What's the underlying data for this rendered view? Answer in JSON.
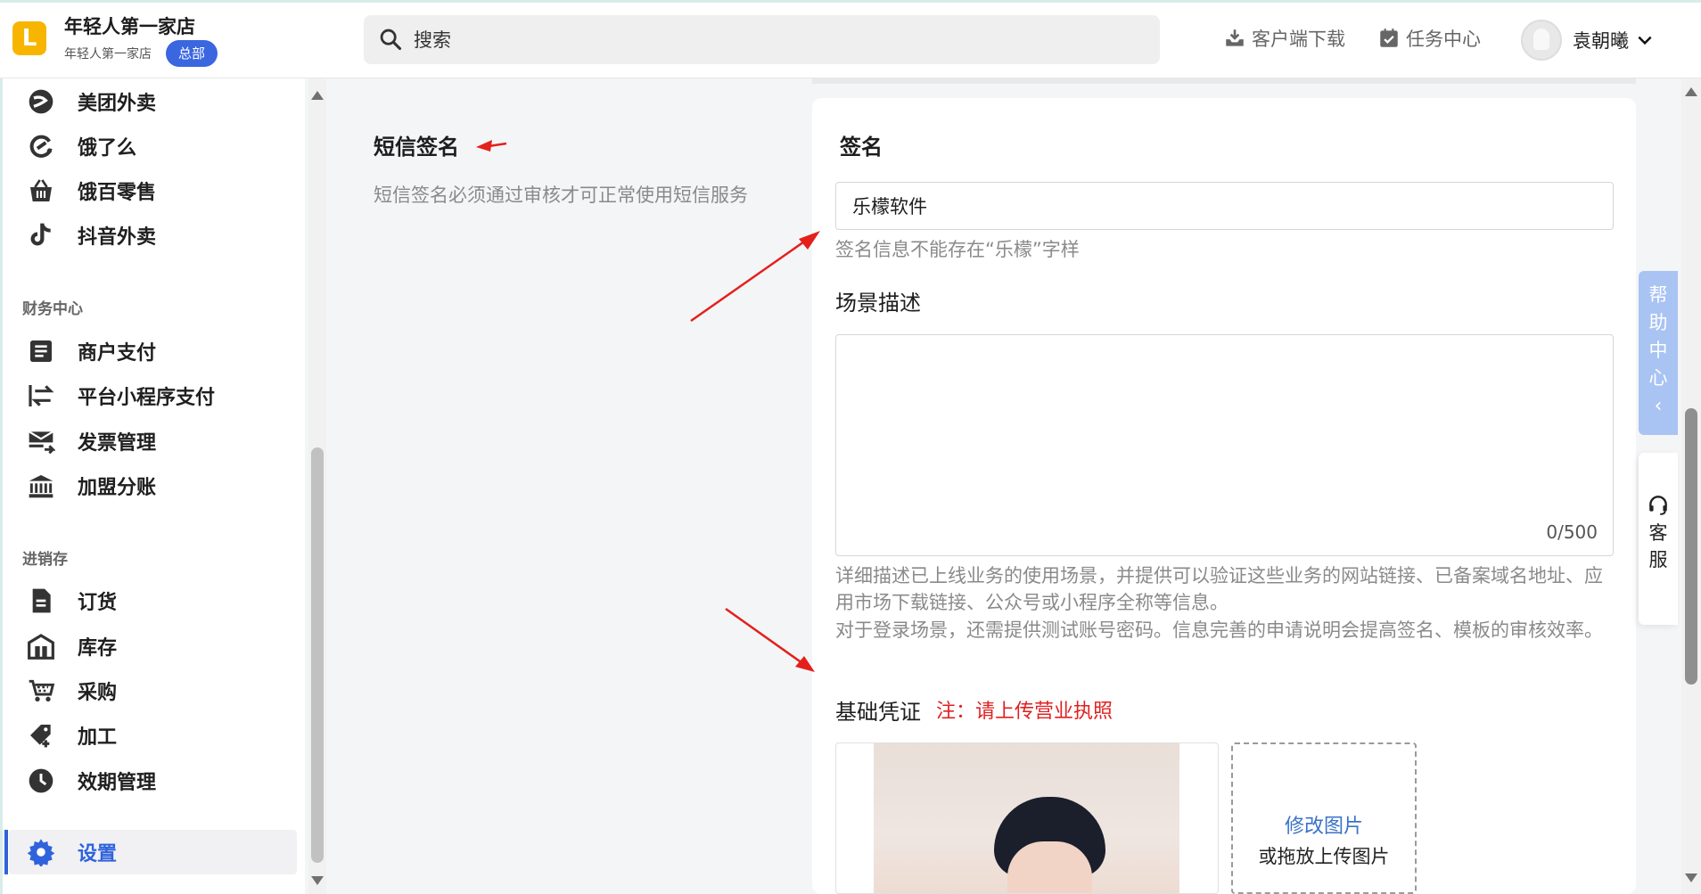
{
  "header": {
    "store_name": "年轻人第一家店",
    "store_sub": "年轻人第一家店",
    "badge": "总部",
    "search_placeholder": "搜索",
    "download_label": "客户端下载",
    "task_label": "任务中心",
    "user_name": "袁朝曦"
  },
  "sidebar": {
    "items_top": [
      {
        "label": "美团外卖",
        "icon": "meituan-icon"
      },
      {
        "label": "饿了么",
        "icon": "eleme-icon"
      },
      {
        "label": "饿百零售",
        "icon": "basket-icon"
      },
      {
        "label": "抖音外卖",
        "icon": "tiktok-icon"
      }
    ],
    "finance_title": "财务中心",
    "finance_items": [
      {
        "label": "商户支付",
        "icon": "document-list-icon"
      },
      {
        "label": "平台小程序支付",
        "icon": "transfer-icon"
      },
      {
        "label": "发票管理",
        "icon": "invoice-mail-icon"
      },
      {
        "label": "加盟分账",
        "icon": "bank-icon"
      }
    ],
    "inventory_title": "进销存",
    "inventory_items": [
      {
        "label": "订货",
        "icon": "order-file-icon"
      },
      {
        "label": "库存",
        "icon": "warehouse-icon"
      },
      {
        "label": "采购",
        "icon": "cart-icon"
      },
      {
        "label": "加工",
        "icon": "tag-plus-icon"
      },
      {
        "label": "效期管理",
        "icon": "clock-icon"
      }
    ],
    "settings": {
      "label": "设置",
      "icon": "gear-icon"
    }
  },
  "section": {
    "title": "短信签名",
    "description": "短信签名必须通过审核才可正常使用短信服务"
  },
  "form": {
    "signature_label": "签名",
    "signature_value": "乐檬软件",
    "signature_hint": "签名信息不能存在“乐檬”字样",
    "scene_label": "场景描述",
    "scene_counter": "0/500",
    "scene_hint_1": "详细描述已上线业务的使用场景，并提供可以验证这些业务的网站链接、已备案域名地址、应用市场下载链接、公众号或小程序全称等信息。",
    "scene_hint_2": "对于登录场景，还需提供测试账号密码。信息完善的申请说明会提高签名、模板的审核效率。",
    "credential_label": "基础凭证",
    "credential_note": "注：请上传营业执照",
    "upload_link": "修改图片",
    "upload_sub": "或拖放上传图片"
  },
  "floating": {
    "help": "帮助中心",
    "help_arrow": "‹",
    "service": "客服"
  },
  "colors": {
    "accent": "#2f63dc",
    "brand_yellow": "#f7b500",
    "note_red": "#e02020",
    "link_blue": "#3a73c9"
  }
}
